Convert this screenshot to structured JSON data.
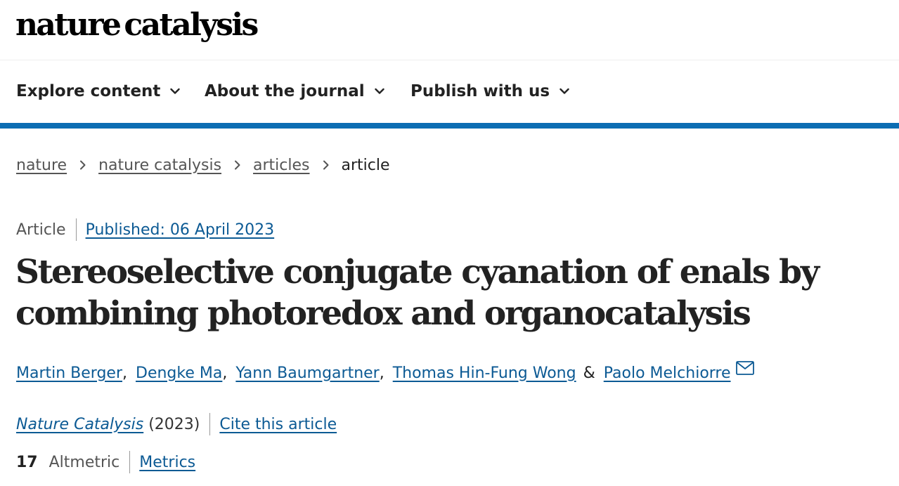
{
  "site": {
    "logo_part1": "nature",
    "logo_part2": "catalysis"
  },
  "nav": {
    "items": [
      {
        "label": "Explore content",
        "icon": "chevron-down-icon"
      },
      {
        "label": "About the journal",
        "icon": "chevron-down-icon"
      },
      {
        "label": "Publish with us",
        "icon": "chevron-down-icon"
      }
    ]
  },
  "colors": {
    "accent_bar": "#0c6db3",
    "link": "#0c5a94",
    "text": "#222222"
  },
  "breadcrumb": {
    "items": [
      "nature",
      "nature catalysis",
      "articles"
    ],
    "current": "article",
    "separator_icon": "chevron-right-icon"
  },
  "article": {
    "type": "Article",
    "published": "Published: 06 April 2023",
    "title": "Stereoselective conjugate cyanation of enals by combining photoredox and organocatalysis",
    "authors": [
      "Martin Berger",
      "Dengke Ma",
      "Yann Baumgartner",
      "Thomas Hin-Fung Wong",
      "Paolo Melchiorre"
    ],
    "author_separator": ",",
    "author_last_joiner": "&",
    "corresponding_icon": "mail-icon",
    "journal": "Nature Catalysis",
    "year": "(2023)",
    "cite_label": "Cite this article",
    "altmetric_score": "17",
    "altmetric_label": "Altmetric",
    "metrics_label": "Metrics"
  }
}
